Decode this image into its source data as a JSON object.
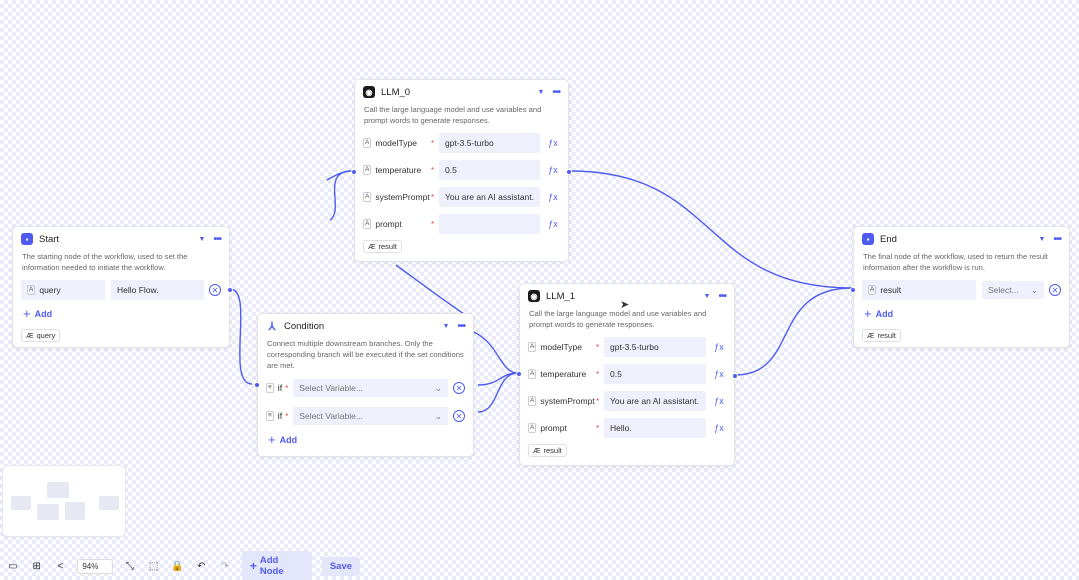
{
  "nodes": {
    "llm0": {
      "title": "LLM_0",
      "description": "Call the large language model and use variables and prompt words to generate responses.",
      "params": [
        {
          "name": "modelType",
          "value": "gpt-3.5-turbo"
        },
        {
          "name": "temperature",
          "value": "0.5"
        },
        {
          "name": "systemPrompt",
          "value": "You are an AI assistant."
        },
        {
          "name": "prompt",
          "value": ""
        }
      ],
      "output": "result"
    },
    "start": {
      "title": "Start",
      "description": "The starting node of the workflow, used to set the information needed to initiate the workflow.",
      "param": {
        "name": "query",
        "value": "Hello Flow."
      },
      "add_label": "Add",
      "output": "query"
    },
    "condition": {
      "title": "Condition",
      "description": "Connect multiple downstream branches. Only the corresponding branch will be executed if the set conditions are met.",
      "rows": [
        {
          "label": "if",
          "placeholder": "Select Variable..."
        },
        {
          "label": "if",
          "placeholder": "Select Variable..."
        }
      ],
      "add_label": "Add"
    },
    "llm1": {
      "title": "LLM_1",
      "description": "Call the large language model and use variables and prompt words to generate responses.",
      "params": [
        {
          "name": "modelType",
          "value": "gpt-3.5-turbo"
        },
        {
          "name": "temperature",
          "value": "0.5"
        },
        {
          "name": "systemPrompt",
          "value": "You are an AI assistant."
        },
        {
          "name": "prompt",
          "value": "Hello."
        }
      ],
      "output": "result"
    },
    "end": {
      "title": "End",
      "description": "The final node of the workflow, used to return the result information after the workflow is run.",
      "param": {
        "name": "result",
        "value": "Select..."
      },
      "add_label": "Add",
      "output": "result"
    }
  },
  "toolbar": {
    "zoom": "94%",
    "add_node_label": "Add Node",
    "save_label": "Save"
  },
  "colors": {
    "accent": "#4f5bf0",
    "canvas_checker": "#e9ebfa"
  }
}
